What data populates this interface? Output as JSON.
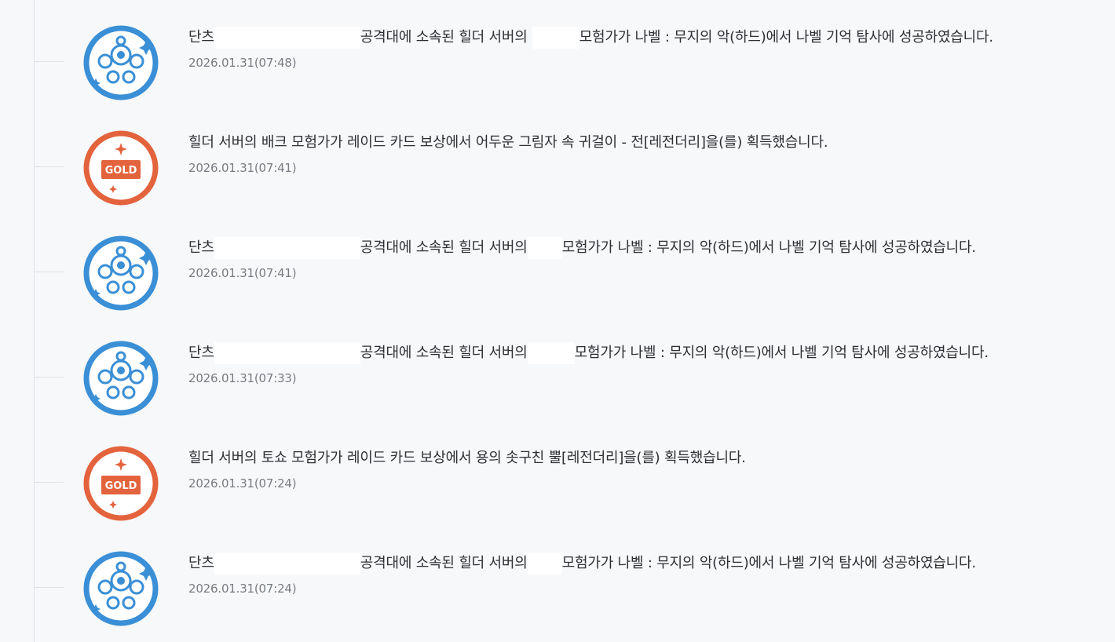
{
  "feed": {
    "items": [
      {
        "icon": "raid-emblem-icon",
        "prefix": "단츠",
        "middle": "공격대에 소속된 힐더 서버의",
        "suffix": "모험가가 나벨 : 무지의 악(하드)에서 나벨 기억 탐사에 성공하였습니다.",
        "date": "2026.01.31(07:48)"
      },
      {
        "icon": "gold-icon",
        "gold_label": "GOLD",
        "message": "힐더 서버의 배크 모험가가 레이드 카드 보상에서 어두운 그림자 속 귀걸이 - 전[레전더리]을(를) 획득했습니다.",
        "date": "2026.01.31(07:41)"
      },
      {
        "icon": "raid-emblem-icon",
        "prefix": "단츠",
        "middle": "공격대에 소속된 힐더 서버의",
        "suffix": "모험가가 나벨 : 무지의 악(하드)에서 나벨 기억 탐사에 성공하였습니다.",
        "date": "2026.01.31(07:41)"
      },
      {
        "icon": "raid-emblem-icon",
        "prefix": "단츠",
        "middle": "공격대에 소속된 힐더 서버의",
        "suffix": "모험가가 나벨 : 무지의 악(하드)에서 나벨 기억 탐사에 성공하였습니다.",
        "date": "2026.01.31(07:33)"
      },
      {
        "icon": "gold-icon",
        "gold_label": "GOLD",
        "message": "힐더 서버의 토쇼 모험가가 레이드 카드 보상에서 용의 솟구친 뿔[레전더리]을(를) 획득했습니다.",
        "date": "2026.01.31(07:24)"
      },
      {
        "icon": "raid-emblem-icon",
        "prefix": "단츠",
        "middle": "공격대에 소속된 힐더 서버의",
        "suffix": "모험가가 나벨 : 무지의 악(하드)에서 나벨 기억 탐사에 성공하였습니다.",
        "date": "2026.01.31(07:24)"
      }
    ]
  },
  "colors": {
    "raid_blue": "#3a8fd6",
    "gold_orange": "#e3633c",
    "text": "#2d2f33",
    "date": "#787c82",
    "background": "#f7f8fa"
  }
}
